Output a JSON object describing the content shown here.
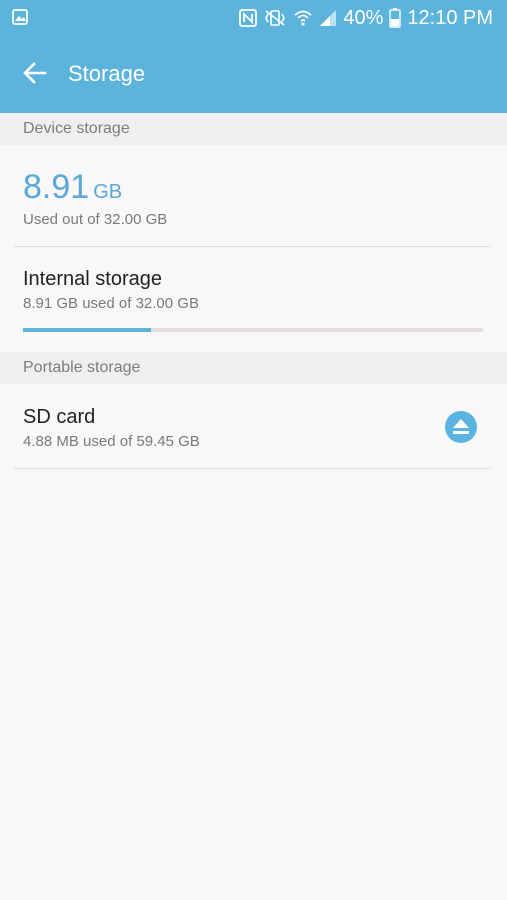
{
  "status_bar": {
    "battery": "40%",
    "time": "12:10 PM",
    "icons": [
      "image-icon",
      "nfc-icon",
      "vibrate-icon",
      "wifi-icon",
      "signal-icon",
      "battery-icon"
    ]
  },
  "toolbar": {
    "title": "Storage",
    "back_icon": "arrow-left-icon"
  },
  "device_storage": {
    "header": "Device storage",
    "used_value": "8.91",
    "used_unit": "GB",
    "used_caption": "Used out of 32.00 GB"
  },
  "internal_storage": {
    "title": "Internal storage",
    "subtitle": "8.91 GB used of 32.00 GB",
    "used_fraction": 0.278
  },
  "portable_storage": {
    "header": "Portable storage",
    "sd_title": "SD card",
    "sd_subtitle": "4.88 MB used of 59.45 GB",
    "eject_icon": "eject-icon"
  },
  "colors": {
    "accent": "#5cb3dc",
    "number_blue": "#5ba7d5"
  }
}
